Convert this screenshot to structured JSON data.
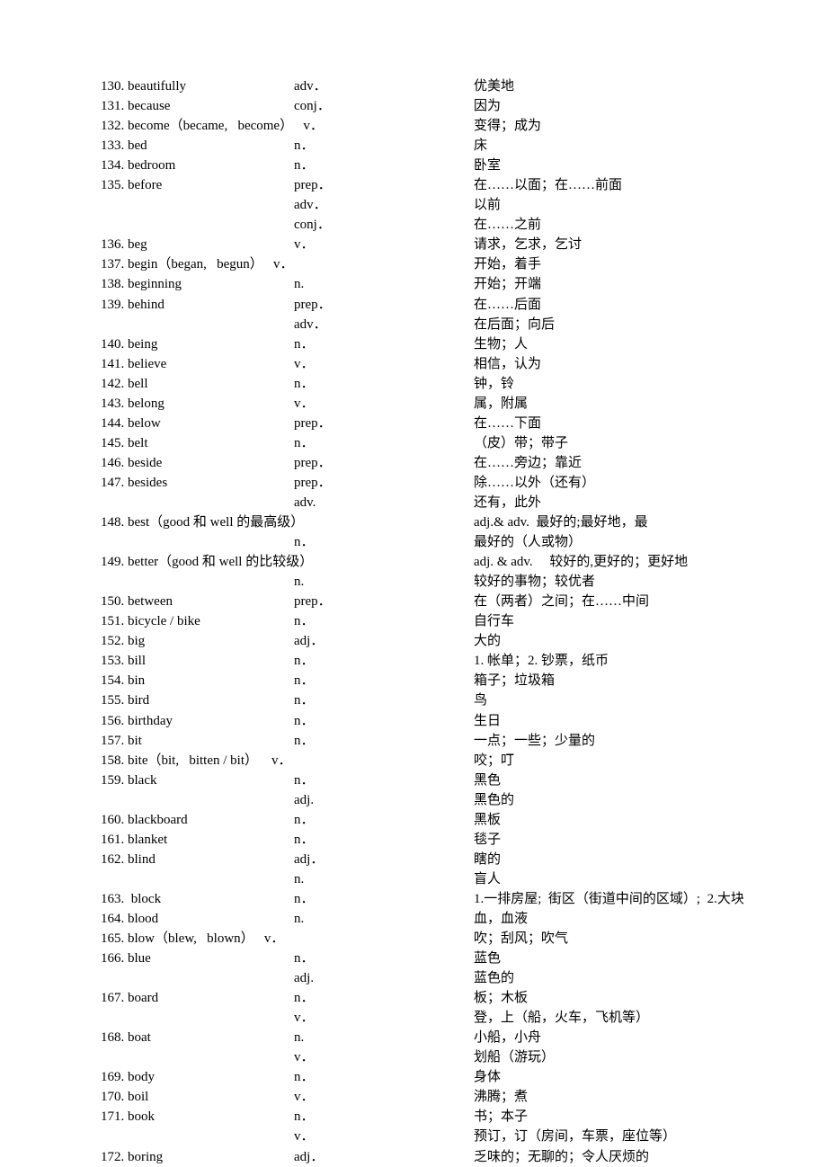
{
  "rows": [
    {
      "c1": "130. beautifully",
      "c2": "adv．",
      "c3": "优美地"
    },
    {
      "c1": "131. because",
      "c2": "conj．",
      "c3": "因为"
    },
    {
      "c1": "132. become（became,   become）   v．",
      "c2": "",
      "c3": "变得；成为"
    },
    {
      "c1": "133. bed",
      "c2": "n．",
      "c3": "床"
    },
    {
      "c1": "134. bedroom",
      "c2": "n．",
      "c3": "卧室"
    },
    {
      "c1": "135. before",
      "c2": "prep．",
      "c3": "在……以面；在……前面"
    },
    {
      "c1": "",
      "c2": "adv．",
      "c3": "以前"
    },
    {
      "c1": "",
      "c2": "conj．",
      "c3": "在……之前"
    },
    {
      "c1": "136. beg",
      "c2": "v．",
      "c3": "请求，乞求，乞讨"
    },
    {
      "c1": "137. begin（began,   begun）   v．",
      "c2": "",
      "c3": "开始，着手"
    },
    {
      "c1": "138. beginning",
      "c2": "n.",
      "c3": "开始；开端"
    },
    {
      "c1": "139. behind",
      "c2": "prep．",
      "c3": "在……后面"
    },
    {
      "c1": "",
      "c2": "adv．",
      "c3": "在后面；向后"
    },
    {
      "c1": "140. being",
      "c2": "n．",
      "c3": "生物；人"
    },
    {
      "c1": "141. believe",
      "c2": "v．",
      "c3": "相信，认为"
    },
    {
      "c1": "142. bell",
      "c2": "n．",
      "c3": "钟，铃"
    },
    {
      "c1": "143. belong",
      "c2": "v．",
      "c3": "属，附属"
    },
    {
      "c1": "144. below",
      "c2": "prep．",
      "c3": "在……下面"
    },
    {
      "c1": "145. belt",
      "c2": "n．",
      "c3": "（皮）带；带子"
    },
    {
      "c1": "146. beside",
      "c2": "prep．",
      "c3": "在……旁边；靠近"
    },
    {
      "c1": "147. besides",
      "c2": "prep．",
      "c3": "除……以外（还有）"
    },
    {
      "c1": "",
      "c2": "adv.",
      "c3": "还有，此外"
    },
    {
      "c1": "148. best（good 和 well 的最高级）",
      "c2": "",
      "c3": "adj.& adv.  最好的;最好地，最"
    },
    {
      "c1": "",
      "c2": "n．",
      "c3": "最好的（人或物）"
    },
    {
      "c1": "149. better（good 和 well 的比较级）",
      "c2": "",
      "c3": "adj. & adv.     较好的,更好的；更好地"
    },
    {
      "c1": "",
      "c2": "n.",
      "c3": "较好的事物；较优者"
    },
    {
      "c1": "150. between",
      "c2": "prep．",
      "c3": "在（两者）之间；在……中间"
    },
    {
      "c1": "151. bicycle / bike",
      "c2": "n．",
      "c3": "自行车"
    },
    {
      "c1": "152. big",
      "c2": "adj．",
      "c3": "大的"
    },
    {
      "c1": "153. bill",
      "c2": "n．",
      "c3": "1. 帐单；2. 钞票，纸币"
    },
    {
      "c1": "154. bin",
      "c2": "n．",
      "c3": "箱子；垃圾箱"
    },
    {
      "c1": "155. bird",
      "c2": "n．",
      "c3": "鸟"
    },
    {
      "c1": "156. birthday",
      "c2": "n．",
      "c3": "生日"
    },
    {
      "c1": "157. bit",
      "c2": "n．",
      "c3": "一点；一些；少量的"
    },
    {
      "c1": "158. bite（bit,   bitten / bit）    v．",
      "c2": "",
      "c3": "咬；叮"
    },
    {
      "c1": "159. black",
      "c2": "n．",
      "c3": "黑色"
    },
    {
      "c1": "",
      "c2": "adj.",
      "c3": "黑色的"
    },
    {
      "c1": "160. blackboard",
      "c2": "n．",
      "c3": "黑板"
    },
    {
      "c1": "161. blanket",
      "c2": "n．",
      "c3": "毯子"
    },
    {
      "c1": "162. blind",
      "c2": "adj．",
      "c3": "瞎的"
    },
    {
      "c1": "",
      "c2": "n.",
      "c3": "盲人"
    },
    {
      "c1": "163.  block",
      "c2": "n．",
      "c3": "1.一排房屋;  街区（街道中间的区域）;  2.大块"
    },
    {
      "c1": "164. blood",
      "c2": "n.",
      "c3": "血，血液"
    },
    {
      "c1": "165. blow（blew,   blown）   v．",
      "c2": "",
      "c3": "吹；刮风；吹气"
    },
    {
      "c1": "166. blue",
      "c2": "n．",
      "c3": "蓝色"
    },
    {
      "c1": "",
      "c2": "adj.",
      "c3": "蓝色的"
    },
    {
      "c1": "167. board",
      "c2": "n．",
      "c3": "板；木板"
    },
    {
      "c1": "",
      "c2": "v．",
      "c3": "登，上（船，火车，飞机等）"
    },
    {
      "c1": "168. boat",
      "c2": "n.",
      "c3": "小船，小舟"
    },
    {
      "c1": "",
      "c2": "v．",
      "c3": "划船（游玩）"
    },
    {
      "c1": "169. body",
      "c2": "n．",
      "c3": "身体"
    },
    {
      "c1": "170. boil",
      "c2": "v．",
      "c3": "沸腾；煮"
    },
    {
      "c1": "171. book",
      "c2": "n．",
      "c3": "书；本子"
    },
    {
      "c1": "",
      "c2": "v．",
      "c3": "预订，订（房间，车票，座位等）"
    },
    {
      "c1": "172. boring",
      "c2": "adj．",
      "c3": "乏味的；无聊的；令人厌烦的"
    }
  ]
}
